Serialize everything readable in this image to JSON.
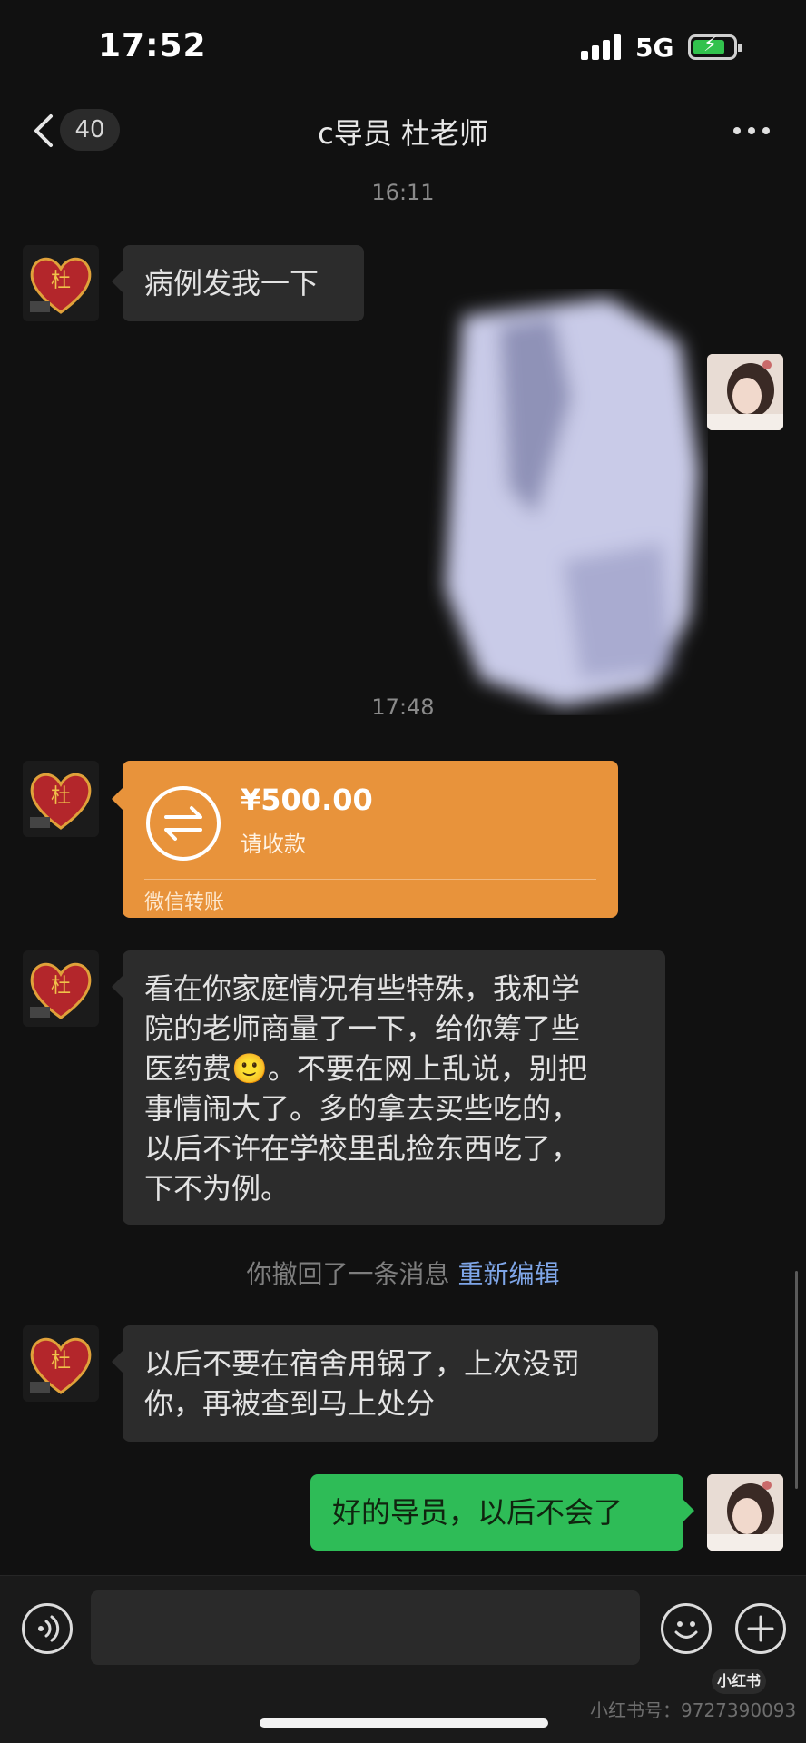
{
  "status_bar": {
    "time": "17:52",
    "network": "5G"
  },
  "nav": {
    "unread_count": "40",
    "title": "c导员 杜老师"
  },
  "timestamps": [
    "16:11",
    "17:48"
  ],
  "messages": {
    "m1": "病例发我一下",
    "m3_lines": [
      "看在你家庭情况有些特殊，我和学",
      "院的老师商量了一下，给你筹了些",
      "医药费🙂。不要在网上乱说，别把",
      "事情闹大了。多的拿去买些吃的，",
      "以后不许在学校里乱捡东西吃了，",
      "下不为例。"
    ],
    "m4_lines": [
      "以后不要在宿舍用锅了，上次没罚",
      "你，再被查到马上处分"
    ],
    "m5": "好的导员，以后不会了"
  },
  "transfer": {
    "amount": "¥500.00",
    "status": "请收款",
    "source": "微信转账"
  },
  "recall": {
    "text": "你撤回了一条消息",
    "action": "重新编辑"
  },
  "avatar_teacher": {
    "label": "杜"
  },
  "watermark": {
    "logo": "小红书",
    "id": "小红书号：9727390093"
  },
  "colors": {
    "sent_bubble": "#2ebc57",
    "transfer_card": "#e8933b",
    "received_bubble": "#2c2c2c"
  }
}
